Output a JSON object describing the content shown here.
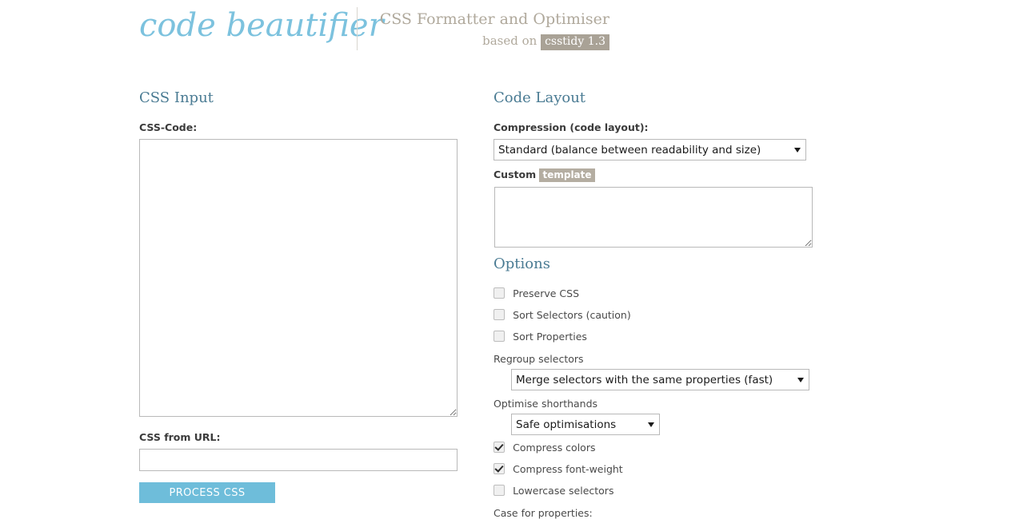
{
  "header": {
    "logo": "code beautifier",
    "tagline": "CSS Formatter and Optimiser",
    "based_on_prefix": "based on",
    "based_on_badge": "csstidy 1.3",
    "logo_color": "#7cc2de",
    "tagline_color": "#b0a99c",
    "badge_bg": "#a9a296"
  },
  "left": {
    "section_title": "CSS Input",
    "css_code_label": "CSS-Code:",
    "css_code_value": "",
    "css_code_placeholder": "",
    "css_url_label": "CSS from URL:",
    "css_url_value": "",
    "css_url_placeholder": "",
    "process_button": "PROCESS CSS",
    "process_button_color": "#6ebdda"
  },
  "right": {
    "section_title": "Code Layout",
    "compression_label": "Compression (code layout):",
    "compression_selected": "Standard (balance between readability and size)",
    "compression_options": [
      "Standard (balance between readability and size)"
    ],
    "custom_label_prefix": "Custom",
    "custom_label_badge": "template",
    "custom_template_value": "",
    "options_title": "Options",
    "checkboxes_top": [
      {
        "label": "Preserve CSS",
        "checked": false
      },
      {
        "label": "Sort Selectors (caution)",
        "checked": false
      },
      {
        "label": "Sort Properties",
        "checked": false
      }
    ],
    "regroup_label": "Regroup selectors",
    "regroup_selected": "Merge selectors with the same properties (fast)",
    "regroup_options": [
      "Merge selectors with the same properties (fast)"
    ],
    "shorthand_label": "Optimise shorthands",
    "shorthand_selected": "Safe optimisations",
    "shorthand_options": [
      "Safe optimisations"
    ],
    "checkboxes_bottom": [
      {
        "label": "Compress colors",
        "checked": true
      },
      {
        "label": "Compress font-weight",
        "checked": true
      },
      {
        "label": "Lowercase selectors",
        "checked": false
      }
    ],
    "case_properties_label": "Case for properties:"
  }
}
